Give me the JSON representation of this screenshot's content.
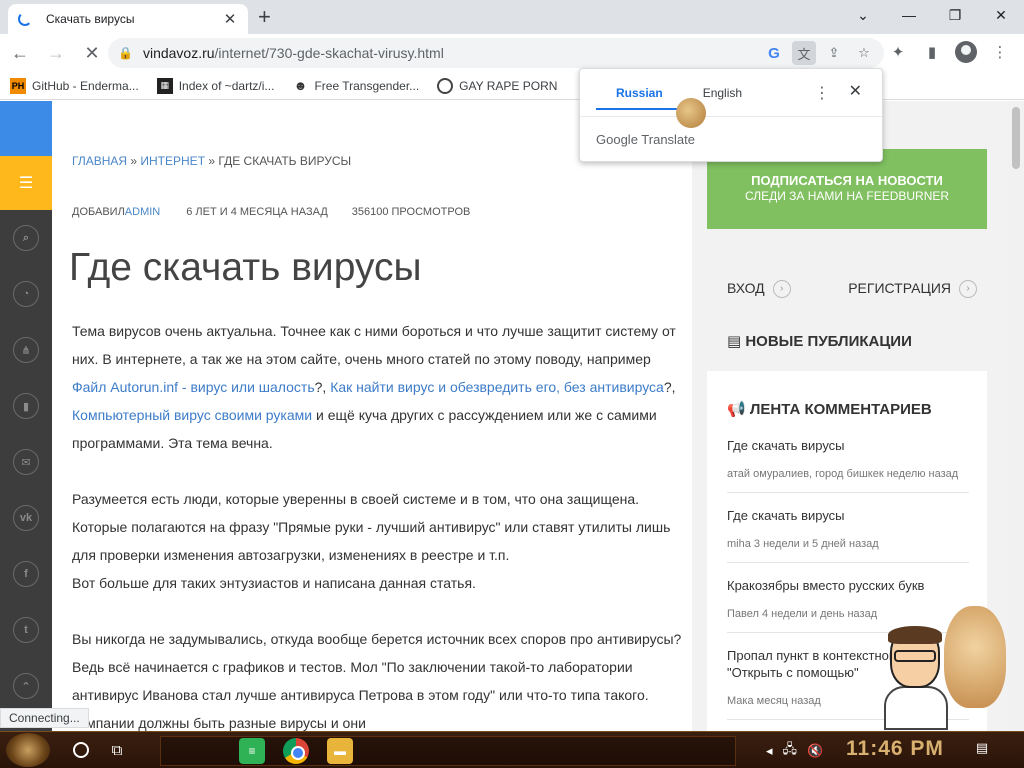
{
  "browser": {
    "tab_title": "Скачать вирусы",
    "url_host": "vindavoz.ru",
    "url_path": "/internet/730-gde-skachat-virusy.html",
    "bookmarks": [
      {
        "label": "GitHub - Enderma...",
        "icon": "ph-icon",
        "badge": "PH"
      },
      {
        "label": "Index of ~dartz/i...",
        "icon": "index-icon"
      },
      {
        "label": "Free Transgender...",
        "icon": "ghost-icon"
      },
      {
        "label": "GAY RAPE PORN",
        "icon": "globe-icon"
      }
    ],
    "status": "Connecting..."
  },
  "translate_popup": {
    "tab_source": "Russian",
    "tab_target": "English",
    "brand": "Google Translate"
  },
  "sidebar_icons": [
    "menu-icon",
    "search-icon",
    "rss-icon",
    "sitemap-icon",
    "bookmark-icon",
    "mail-icon",
    "vk-icon",
    "facebook-icon",
    "twitter-icon",
    "up-icon"
  ],
  "breadcrumb": {
    "home": "ГЛАВНАЯ",
    "sep1": " » ",
    "section": "ИНТЕРНЕТ",
    "sep2": " » ",
    "current": "ГДЕ СКАЧАТЬ ВИРУСЫ"
  },
  "meta": {
    "added_by_label": "ДОБАВИЛ ",
    "author": "ADMIN",
    "ago": "6 ЛЕТ И 4 МЕСЯЦА НАЗАД",
    "views": "356100 ПРОСМОТРОВ"
  },
  "article": {
    "title": "Где скачать вирусы",
    "p1_text1": "Тема вирусов очень актуальна. Точнее как с ними бороться и что лучше защитит систему от них. В интернете, а так же на этом сайте, очень много статей по этому поводу, например ",
    "p1_link1": "Файл Autorun.inf - вирус или шалость",
    "p1_text2": "?, ",
    "p1_link2": "Как найти вирус и обезвредить его, без антивируса",
    "p1_text3": "?, ",
    "p1_link3": "Компьютерный вирус своими руками",
    "p1_text4": " и ещё куча других с рассуждением или же с самими программами. Эта тема вечна.",
    "p2_line1": "Разумеется есть люди, которые уверенны в своей системе и в том, что она защищена. Которые полагаются на фразу \"Прямые руки - лучший антивирус\" или ставят утилиты лишь для проверки изменения автозагрузки, изменениях в реестре и т.п.",
    "p2_line2": "Вот больше для таких энтузиастов и написана данная статья.",
    "p3": "Вы никогда не задумывались, откуда вообще берется источник всех споров про антивирусы? Ведь всё начинается с графиков и тестов. Мол \"По заключении такой-то лаборатории антивирус Иванова стал лучше антивируса Петрова в этом году\" или что-то типа такого. ",
    "p3_tail": "компании должны быть разные вирусы и они"
  },
  "sidebar": {
    "subscribe_line1": "ПОДПИСАТЬСЯ НА НОВОСТИ",
    "subscribe_line2": "СЛЕДИ ЗА НАМИ НА FEEDBURNER",
    "login": "ВХОД",
    "register": "РЕГИСТРАЦИЯ",
    "new_pubs": "НОВЫЕ ПУБЛИКАЦИИ",
    "feed_title": "ЛЕНТА КОММЕНТАРИЕВ",
    "feed": [
      {
        "title": "Где скачать вирусы",
        "meta": "атай омуралиев, город бишкек неделю назад"
      },
      {
        "title": "Где скачать вирусы",
        "meta": "miha 3 недели и 5 дней назад"
      },
      {
        "title": "Кракозябры вместо русских букв",
        "meta": "Павел 4 недели и день назад"
      },
      {
        "title": "Пропал пункт в контекстном меню \"Открыть с помощью\"",
        "meta": "Мака месяц назад"
      }
    ]
  },
  "taskbar": {
    "clock": "11:46 PM"
  }
}
